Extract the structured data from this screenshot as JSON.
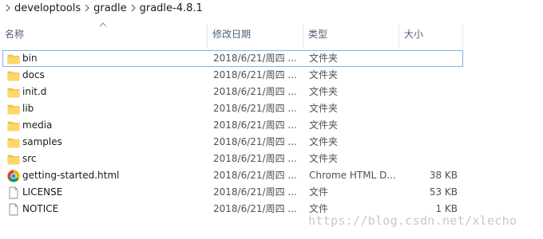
{
  "breadcrumb": [
    "developtools",
    "gradle",
    "gradle-4.8.1"
  ],
  "columns": {
    "name": "名称",
    "date": "修改日期",
    "type": "类型",
    "size": "大小"
  },
  "files": [
    {
      "name": "bin",
      "date": "2018/6/21/周四 ...",
      "type": "文件夹",
      "size": "",
      "icon": "folder-icon"
    },
    {
      "name": "docs",
      "date": "2018/6/21/周四 ...",
      "type": "文件夹",
      "size": "",
      "icon": "folder-icon"
    },
    {
      "name": "init.d",
      "date": "2018/6/21/周四 ...",
      "type": "文件夹",
      "size": "",
      "icon": "folder-icon"
    },
    {
      "name": "lib",
      "date": "2018/6/21/周四 ...",
      "type": "文件夹",
      "size": "",
      "icon": "folder-icon"
    },
    {
      "name": "media",
      "date": "2018/6/21/周四 ...",
      "type": "文件夹",
      "size": "",
      "icon": "folder-icon"
    },
    {
      "name": "samples",
      "date": "2018/6/21/周四 ...",
      "type": "文件夹",
      "size": "",
      "icon": "folder-icon"
    },
    {
      "name": "src",
      "date": "2018/6/21/周四 ...",
      "type": "文件夹",
      "size": "",
      "icon": "folder-icon"
    },
    {
      "name": "getting-started.html",
      "date": "2018/6/21/周四 ...",
      "type": "Chrome HTML D...",
      "size": "38 KB",
      "icon": "chrome-icon"
    },
    {
      "name": "LICENSE",
      "date": "2018/6/21/周四 ...",
      "type": "文件",
      "size": "53 KB",
      "icon": "file-icon"
    },
    {
      "name": "NOTICE",
      "date": "2018/6/21/周四 ...",
      "type": "文件",
      "size": "1 KB",
      "icon": "file-icon"
    }
  ],
  "watermark": "https://blog.csdn.net/xlecho",
  "colors": {
    "selection_border": "#7eb4ea",
    "folder": "#f6c94a",
    "header_text": "#4c607a"
  }
}
